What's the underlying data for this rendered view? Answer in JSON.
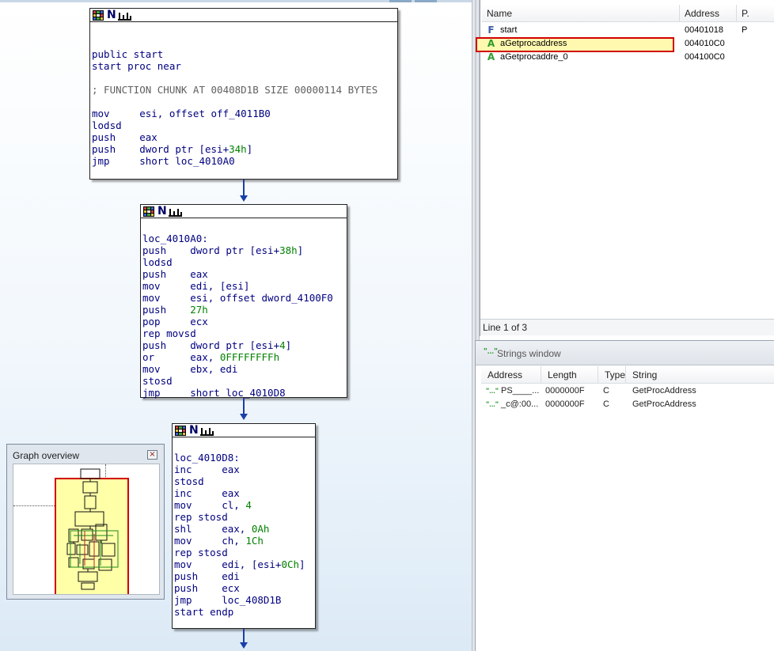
{
  "graph": {
    "node1": {
      "lines": [
        "",
        "",
        "public start",
        "start proc near",
        "",
        "; FUNCTION CHUNK AT 00408D1B SIZE 00000114 BYTES",
        "",
        "mov     esi, offset off_4011B0",
        "lodsd",
        "push    eax",
        "push    dword ptr [esi+34h]",
        "jmp     short loc_4010A0"
      ]
    },
    "node2": {
      "lines": [
        "",
        "loc_4010A0:",
        "push    dword ptr [esi+38h]",
        "lodsd",
        "push    eax",
        "mov     edi, [esi]",
        "mov     esi, offset dword_4100F0",
        "push    27h",
        "pop     ecx",
        "rep movsd",
        "push    dword ptr [esi+4]",
        "or      eax, 0FFFFFFFFh",
        "mov     ebx, edi",
        "stosd",
        "jmp     short loc_4010D8"
      ]
    },
    "node3": {
      "lines": [
        "",
        "loc_4010D8:",
        "inc     eax",
        "stosd",
        "inc     eax",
        "mov     cl, 4",
        "rep stosd",
        "shl     eax, 0Ah",
        "mov     ch, 1Ch",
        "rep stosd",
        "mov     edi, [esi+0Ch]",
        "push    edi",
        "push    ecx",
        "jmp     loc_408D1B",
        "start endp"
      ]
    },
    "node_header_icons": [
      "flowchart-grid-icon",
      "n-icon",
      "w-icon"
    ]
  },
  "overview": {
    "title": "Graph overview",
    "close_glyph": "×"
  },
  "names_window": {
    "columns": [
      "Name",
      "Address",
      "P."
    ],
    "rows": [
      {
        "icon": "F",
        "name": "start",
        "address": "00401018",
        "p": "P"
      },
      {
        "icon": "A",
        "name": "aGetprocaddress",
        "address": "004010C0",
        "p": ""
      },
      {
        "icon": "A",
        "name": "aGetprocaddre_0",
        "address": "004100C0",
        "p": ""
      }
    ],
    "status": "Line 1 of 3",
    "selected_row": 1
  },
  "strings_window": {
    "title": "Strings window",
    "title_glyph": "\"...\"",
    "columns": [
      "Address",
      "Length",
      "Type",
      "String"
    ],
    "rows": [
      {
        "address": "PS____...",
        "length": "0000000F",
        "type": "C",
        "string": "GetProcAddress"
      },
      {
        "address": "_c@:00...",
        "length": "0000000F",
        "type": "C",
        "string": "GetProcAddress"
      }
    ]
  },
  "colors": {
    "accent_red": "#d00000",
    "highlight_yellow": "#fff9b0",
    "code_blue": "#000080",
    "code_green": "#008000",
    "arrow_blue": "#1b3fa8"
  }
}
